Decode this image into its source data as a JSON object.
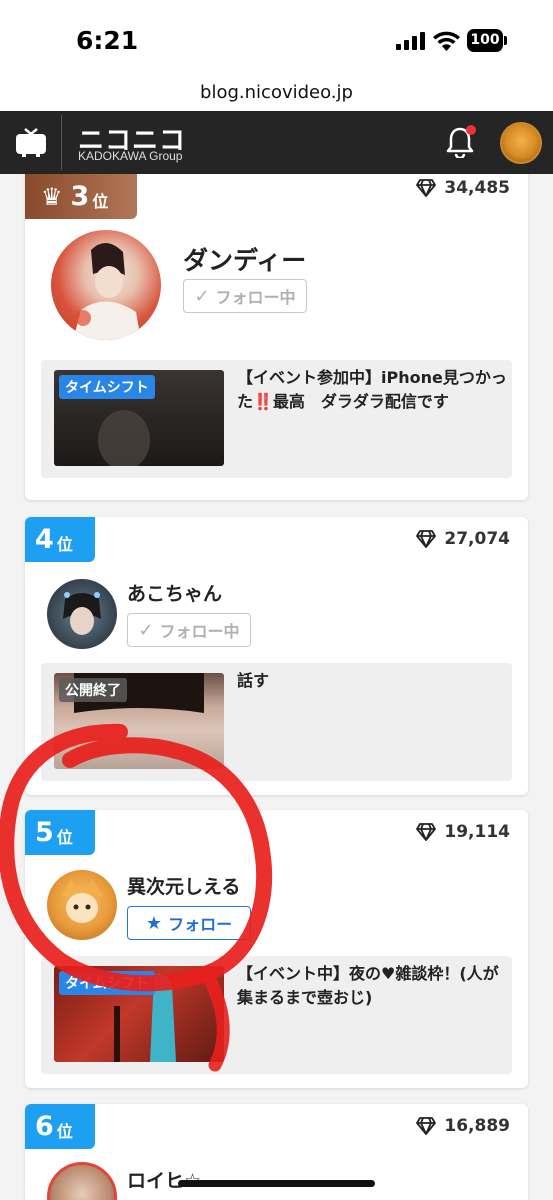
{
  "status_bar": {
    "time": "6:21",
    "battery": "100"
  },
  "browser": {
    "url": "blog.nicovideo.jp"
  },
  "header": {
    "logo": "ニコニコ",
    "logo_sub": "KADOKAWA Group"
  },
  "ranking": [
    {
      "rank": "3",
      "unit": "位",
      "points": "34,485",
      "name": "ダンディー",
      "follow_label": "フォロー中",
      "program_tag": "タイムシフト",
      "program_title": "【イベント参加中】iPhone見つかった‼️最高　ダラダラ配信です"
    },
    {
      "rank": "4",
      "unit": "位",
      "points": "27,074",
      "name": "あこちゃん",
      "follow_label": "フォロー中",
      "program_tag": "公開終了",
      "program_title": "話す"
    },
    {
      "rank": "5",
      "unit": "位",
      "points": "19,114",
      "name": "異次元しえる",
      "follow_label": "フォロー",
      "program_tag": "タイムシフト",
      "program_title": "【イベント中】夜の♥雑談枠！(人が集まるまで壺おじ)"
    },
    {
      "rank": "6",
      "unit": "位",
      "points": "16,889",
      "name": "ロイヒ☆"
    }
  ],
  "colors": {
    "rank_blue": "#1ea0f2",
    "follow_blue": "#1e6fd0",
    "header_bg": "#252525",
    "highlight_red": "#e8201c"
  }
}
